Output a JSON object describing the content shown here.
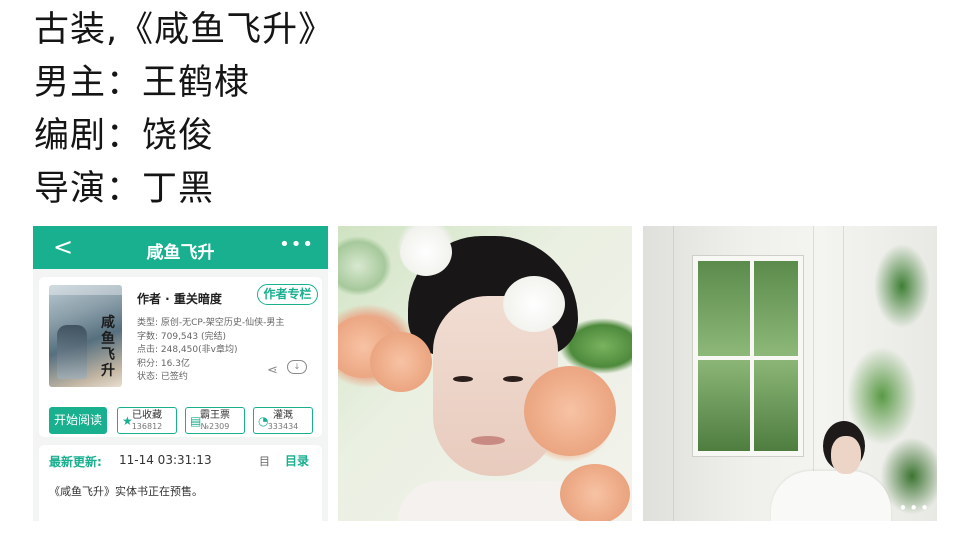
{
  "caption": {
    "line1": "古装,《咸鱼飞升》",
    "line2": "男主：王鹤棣",
    "line3": "编剧：饶俊",
    "line4": "导演：丁黑"
  },
  "app": {
    "back": "<",
    "title": "咸鱼飞升",
    "more": "•••",
    "cover_title": "咸鱼飞升",
    "author": "作者 · 重关暗度",
    "author_column": "作者专栏",
    "meta": {
      "category": "类型: 原创-无CP-架空历史-仙侠-男主",
      "words": "字数: 709,543 (完结)",
      "clicks": "点击: 248,450(非v章均)",
      "points": "积分: 16.3亿",
      "status": "状态: 已签约"
    },
    "share": "⋖",
    "download": "↓",
    "read_button": "开始阅读",
    "collect_label": "已收藏",
    "collect_count": "136812",
    "ticket_label": "霸王票",
    "ticket_count": "№2309",
    "water_label": "灌溉",
    "water_count": "333434",
    "latest_label": "最新更新:",
    "latest_time": "11-14 03:31:13",
    "sort_icon": "目",
    "directory": "目录",
    "notice": "《咸鱼飞升》实体书正在预售。"
  },
  "colors": {
    "accent": "#19b08f"
  },
  "photos": {
    "more": "•••"
  }
}
